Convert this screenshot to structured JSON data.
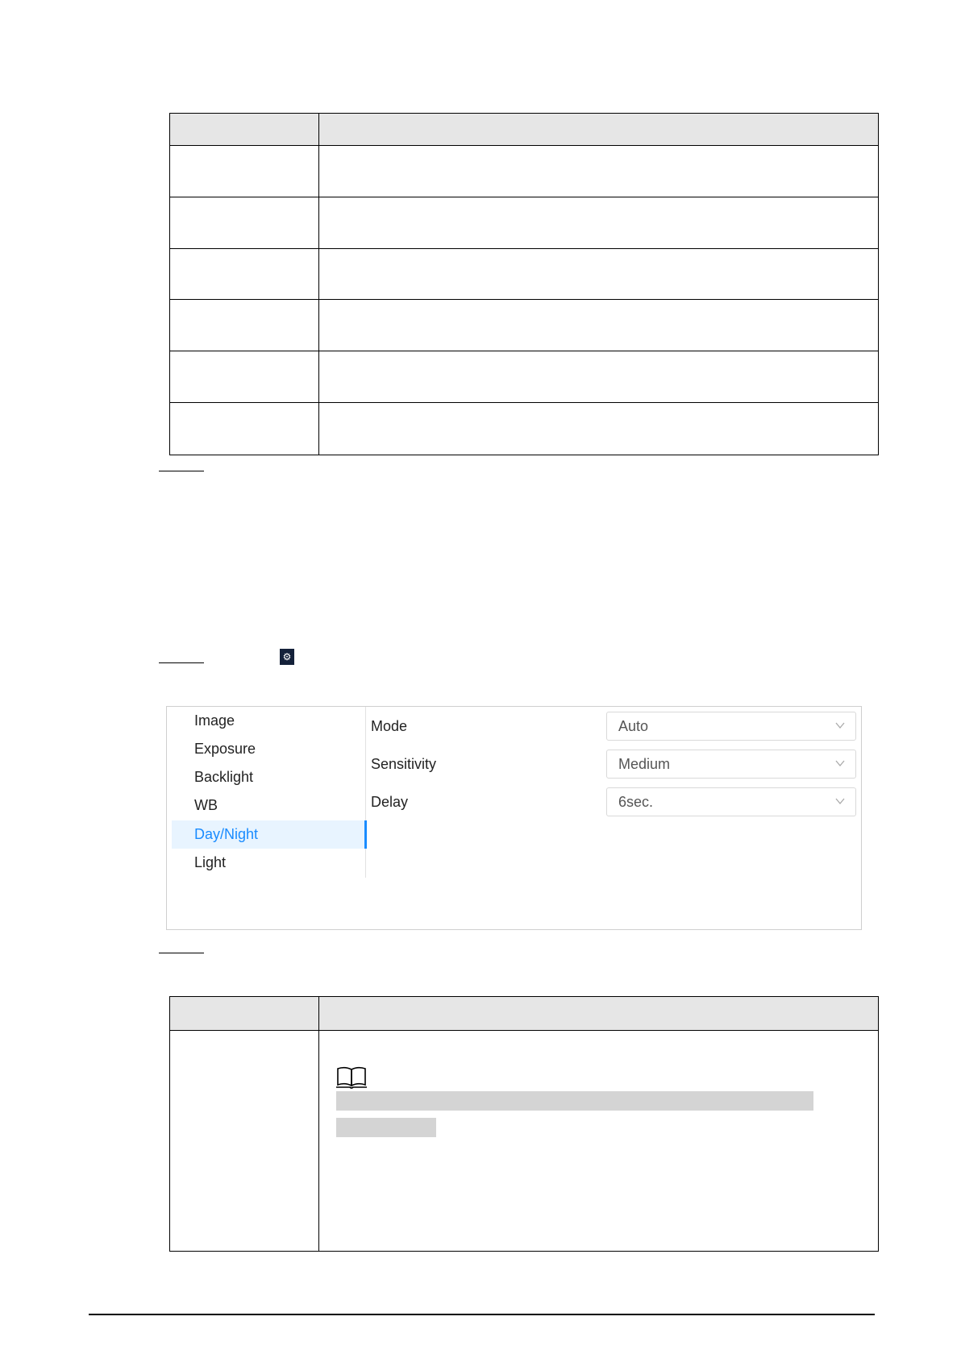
{
  "table1": {
    "rows": 6
  },
  "panel": {
    "menu": [
      "Image",
      "Exposure",
      "Backlight",
      "WB",
      "Day/Night",
      "Light"
    ],
    "active_menu": "Day/Night",
    "fields": [
      {
        "label": "Mode",
        "value": "Auto"
      },
      {
        "label": "Sensitivity",
        "value": "Medium"
      },
      {
        "label": "Delay",
        "value": "6sec."
      }
    ]
  },
  "icons": {
    "gear": "gear-icon",
    "chevron": "chevron-down-icon",
    "note": "book-note-icon"
  },
  "colors": {
    "accent": "#1a8cff",
    "active_bg": "#e8f4ff",
    "table_header": "#e6e6e6",
    "gear_bg": "#14213a"
  }
}
